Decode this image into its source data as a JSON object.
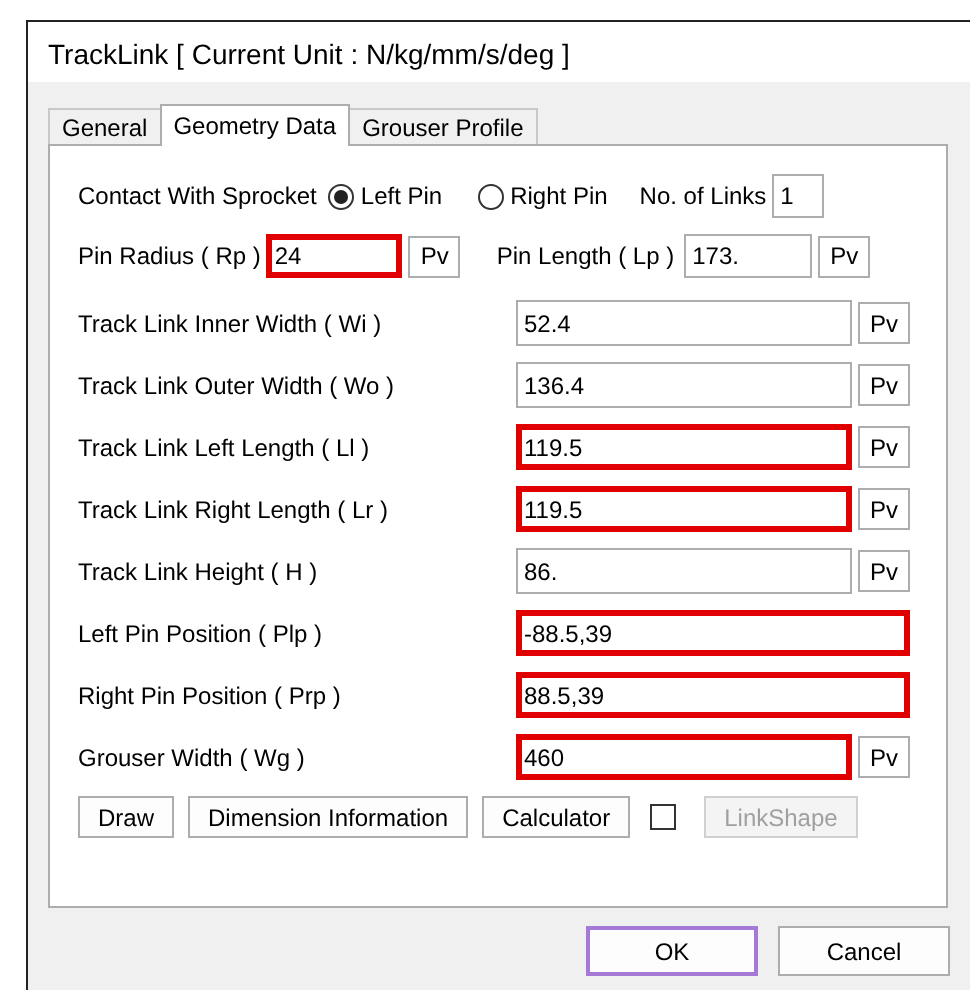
{
  "window": {
    "title": "TrackLink [ Current Unit : N/kg/mm/s/deg ]"
  },
  "tabs": [
    {
      "label": "General",
      "selected": false
    },
    {
      "label": "Geometry Data",
      "selected": true
    },
    {
      "label": "Grouser Profile",
      "selected": false
    }
  ],
  "contact": {
    "label": "Contact With Sprocket",
    "options": [
      {
        "label": "Left Pin",
        "selected": true
      },
      {
        "label": "Right Pin",
        "selected": false
      }
    ],
    "links_label": "No. of Links",
    "links_value": "1"
  },
  "pin_row": [
    {
      "label": "Pin Radius ( Rp )",
      "value": "24",
      "highlighted": true,
      "button": "Pv"
    },
    {
      "label": "Pin Length ( Lp )",
      "value": "173.",
      "highlighted": false,
      "button": "Pv"
    }
  ],
  "fields": [
    {
      "label": "Track Link Inner Width ( Wi )",
      "value": "52.4",
      "highlighted": false,
      "button": "Pv"
    },
    {
      "label": "Track Link Outer Width ( Wo )",
      "value": "136.4",
      "highlighted": false,
      "button": "Pv"
    },
    {
      "label": "Track Link Left Length ( Ll )",
      "value": "119.5",
      "highlighted": true,
      "button": "Pv"
    },
    {
      "label": "Track Link Right Length ( Lr )",
      "value": "119.5",
      "highlighted": true,
      "button": "Pv"
    },
    {
      "label": "Track Link Height ( H )",
      "value": "86.",
      "highlighted": false,
      "button": "Pv"
    },
    {
      "label": "Left Pin Position ( Plp )",
      "value": "-88.5,39",
      "highlighted": true
    },
    {
      "label": "Right Pin Position ( Prp )",
      "value": "88.5,39",
      "highlighted": true
    },
    {
      "label": "Grouser Width ( Wg )",
      "value": "460",
      "highlighted": true,
      "button": "Pv"
    }
  ],
  "actions": [
    {
      "kind": "button",
      "label": "Draw",
      "disabled": false
    },
    {
      "kind": "button",
      "label": "Dimension Information",
      "disabled": false
    },
    {
      "kind": "button",
      "label": "Calculator",
      "disabled": false
    },
    {
      "kind": "checkbox",
      "checked": false
    },
    {
      "kind": "button",
      "label": "LinkShape",
      "disabled": true
    }
  ],
  "footer": [
    {
      "label": "OK",
      "default": true
    },
    {
      "label": "Cancel",
      "default": false
    }
  ]
}
